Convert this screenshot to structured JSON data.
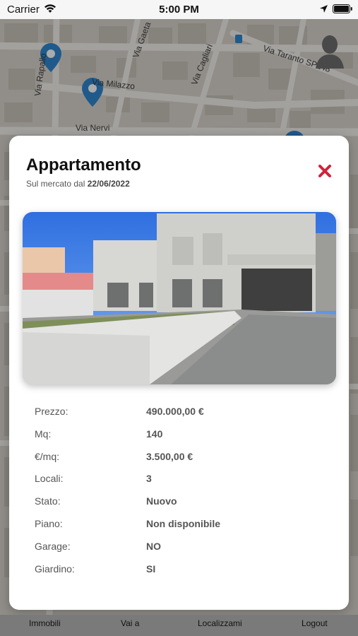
{
  "status_bar": {
    "carrier": "Carrier",
    "time": "5:00 PM"
  },
  "map": {
    "streets": [
      "Via Rapallo",
      "Via Milazzo",
      "Via Gaeta",
      "Via Cagliari",
      "Via Taranto SP148",
      "Via Nervi"
    ]
  },
  "modal": {
    "title": "Appartamento",
    "since_prefix": "Sul mercato dal",
    "since_date": "22/06/2022",
    "details": [
      {
        "label": "Prezzo:",
        "value": "490.000,00 €"
      },
      {
        "label": "Mq:",
        "value": "140"
      },
      {
        "label": "€/mq:",
        "value": "3.500,00 €"
      },
      {
        "label": "Locali:",
        "value": "3"
      },
      {
        "label": "Stato:",
        "value": "Nuovo"
      },
      {
        "label": "Piano:",
        "value": "Non disponibile"
      },
      {
        "label": "Garage:",
        "value": "NO"
      },
      {
        "label": "Giardino:",
        "value": "SI"
      }
    ]
  },
  "tabbar": {
    "tabs": [
      "Immobili",
      "Vai a",
      "Localizzami",
      "Logout"
    ]
  },
  "colors": {
    "close_icon": "#d0233a",
    "map_pin": "#2f86cf"
  },
  "icons": [
    "wifi-icon",
    "location-arrow-icon",
    "battery-icon",
    "map-pin-icon",
    "avatar-icon",
    "close-icon"
  ]
}
